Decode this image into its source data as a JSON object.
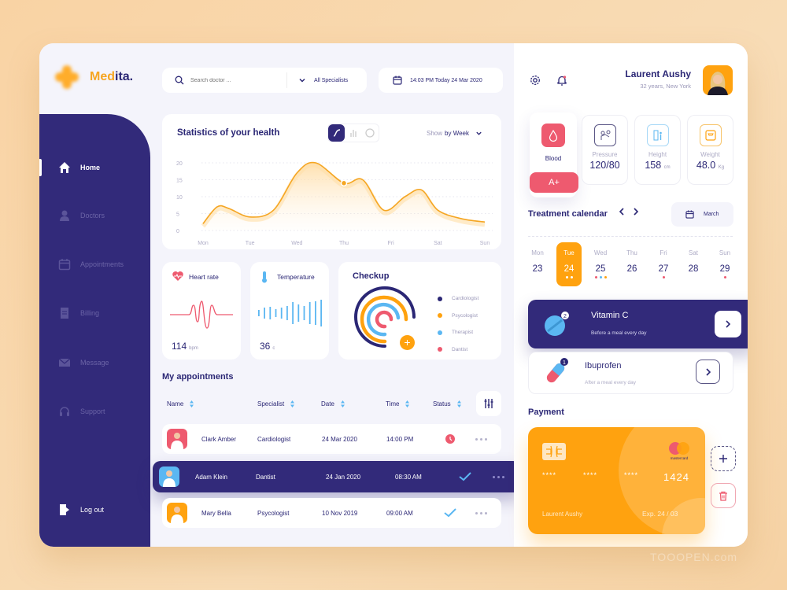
{
  "app": {
    "brand_prefix": "Med",
    "brand_suffix": "ita."
  },
  "sidebar": {
    "items": [
      {
        "label": "Home",
        "icon": "home-icon",
        "active": true
      },
      {
        "label": "Doctors",
        "icon": "user-icon"
      },
      {
        "label": "Appointments",
        "icon": "calendar-icon"
      },
      {
        "label": "Billing",
        "icon": "receipt-icon"
      },
      {
        "label": "Message",
        "icon": "mail-icon"
      },
      {
        "label": "Support",
        "icon": "headset-icon"
      }
    ],
    "logout": "Log out"
  },
  "search": {
    "placeholder": "Search doctor ...",
    "specialist": "All Specialists"
  },
  "datetime": "14:03 PM Today 24 Mar 2020",
  "stats": {
    "title": "Statistics of your health",
    "show_label": "Show",
    "show_value": "by Week",
    "chart_types": [
      "line",
      "bar",
      "donut"
    ]
  },
  "chart_data": {
    "type": "area",
    "title": "Statistics of your health",
    "categories": [
      "Mon",
      "Tue",
      "Wed",
      "Thu",
      "Fri",
      "Sat",
      "Sun"
    ],
    "x": [
      0,
      0.3,
      0.55,
      1,
      1.5,
      2,
      2.4,
      3,
      3.4,
      3.85,
      4.3,
      4.65,
      5,
      5.5,
      6
    ],
    "values": [
      2,
      7,
      6.5,
      4,
      6,
      17,
      20,
      14,
      15,
      6,
      10,
      12,
      6,
      3.5,
      2.5
    ],
    "highlight": {
      "x": 3,
      "y": 14
    },
    "yticks": [
      0,
      5,
      10,
      15,
      20
    ],
    "ylim": [
      0,
      20
    ],
    "xlabel": "",
    "ylabel": "",
    "grid": true,
    "color": "#f5a623"
  },
  "vitals_mini": {
    "heart": {
      "title": "Heart rate",
      "value": "114",
      "unit": "bpm"
    },
    "temp": {
      "title": "Temperature",
      "value": "36",
      "unit": "c"
    }
  },
  "checkup": {
    "title": "Checkup",
    "legend": [
      {
        "label": "Cardiologist",
        "color": "#2b2775"
      },
      {
        "label": "Psycologist",
        "color": "#ffa20f"
      },
      {
        "label": "Therapist",
        "color": "#5bb7f2"
      },
      {
        "label": "Dantist",
        "color": "#ee5a6f"
      }
    ]
  },
  "appointments": {
    "title": "My appointments",
    "headers": [
      "Name",
      "Specialist",
      "Date",
      "Time",
      "Status"
    ],
    "rows": [
      {
        "name": "Clark Amber",
        "specialist": "Cardiologist",
        "date": "24 Mar 2020",
        "time": "14:00 PM",
        "status": "pending"
      },
      {
        "name": "Adam Klein",
        "specialist": "Dantist",
        "date": "24 Jan 2020",
        "time": "08:30 AM",
        "status": "done"
      },
      {
        "name": "Mary Bella",
        "specialist": "Psycologist",
        "date": "10 Nov 2019",
        "time": "09:00 AM",
        "status": "done"
      }
    ]
  },
  "user": {
    "name": "Laurent Aushy",
    "sub": "32 years, New York"
  },
  "vitals": {
    "blood": {
      "label": "Blood",
      "value": "A+"
    },
    "pressure": {
      "label": "Pressure",
      "value": "120/80"
    },
    "height": {
      "label": "Height",
      "value": "158",
      "unit": "cm"
    },
    "weight": {
      "label": "Weight",
      "value": "48.0",
      "unit": "Kg"
    }
  },
  "calendar": {
    "title": "Treatment calendar",
    "month": "March",
    "days": [
      {
        "dn": "Mon",
        "dd": "23",
        "dots": []
      },
      {
        "dn": "Tue",
        "dd": "24",
        "dots": [
          "#fff",
          "#fff"
        ],
        "selected": true
      },
      {
        "dn": "Wed",
        "dd": "25",
        "dots": [
          "#ee5a6f",
          "#5bb7f2",
          "#ffa20f"
        ]
      },
      {
        "dn": "Thu",
        "dd": "26",
        "dots": []
      },
      {
        "dn": "Fri",
        "dd": "27",
        "dots": [
          "#ee5a6f"
        ]
      },
      {
        "dn": "Sat",
        "dd": "28",
        "dots": []
      },
      {
        "dn": "Sun",
        "dd": "29",
        "dots": [
          "#ee5a6f"
        ]
      }
    ]
  },
  "meds": [
    {
      "name": "Vitamin C",
      "sub": "Before a meal every day",
      "count": "2"
    },
    {
      "name": "Ibuprofen",
      "sub": "After a meal every day",
      "count": "1"
    }
  ],
  "payment": {
    "title": "Payment",
    "masked": "****",
    "last4": "1424",
    "holder": "Laurent Aushy",
    "exp": "Exp. 24 / 03",
    "brand": "mastercard"
  },
  "watermark": "TOOOPEN.com"
}
